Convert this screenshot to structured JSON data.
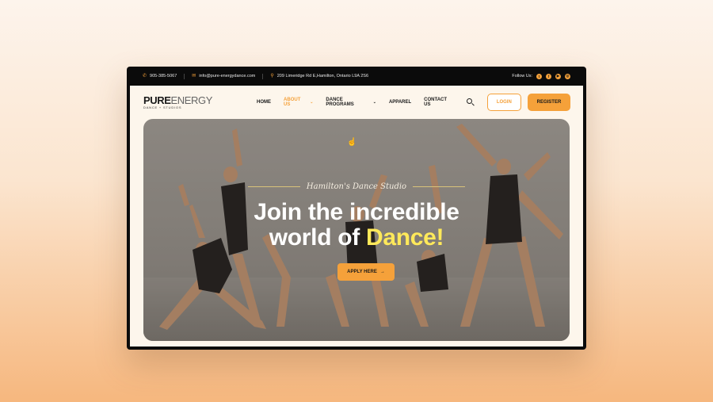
{
  "topbar": {
    "phone": "905-385-5067",
    "email": "info@pure-energydance.com",
    "address": "209 Limeridge Rd E,Hamilton, Ontario L9A 2S6",
    "follow_label": "Follow Us:",
    "social": [
      "twitter-icon",
      "facebook-icon",
      "youtube-icon",
      "instagram-icon"
    ]
  },
  "logo": {
    "name_main": "PURE",
    "name_accent": "ENERGY",
    "tagline": "DANCE + STUDIOS"
  },
  "nav": {
    "items": [
      {
        "label": "HOME"
      },
      {
        "label": "ABOUT US"
      },
      {
        "label": "DANCE PROGRAMS"
      },
      {
        "label": "APPAREL"
      },
      {
        "label": "CONTACT US"
      }
    ],
    "login_label": "LOGIN",
    "register_label": "REGISTER"
  },
  "hero": {
    "kicker": "Hamilton's Dance Studio",
    "headline_line1": "Join the incredible",
    "headline_line2_prefix": "world of ",
    "headline_highlight": "Dance!",
    "cta_label": "APPLY HERE",
    "cta_arrow": "→"
  },
  "colors": {
    "accent": "#f5a13a",
    "highlight": "#ffe95a",
    "topbar_bg": "#0b0b0b",
    "page_bg": "#fdf6ec"
  }
}
